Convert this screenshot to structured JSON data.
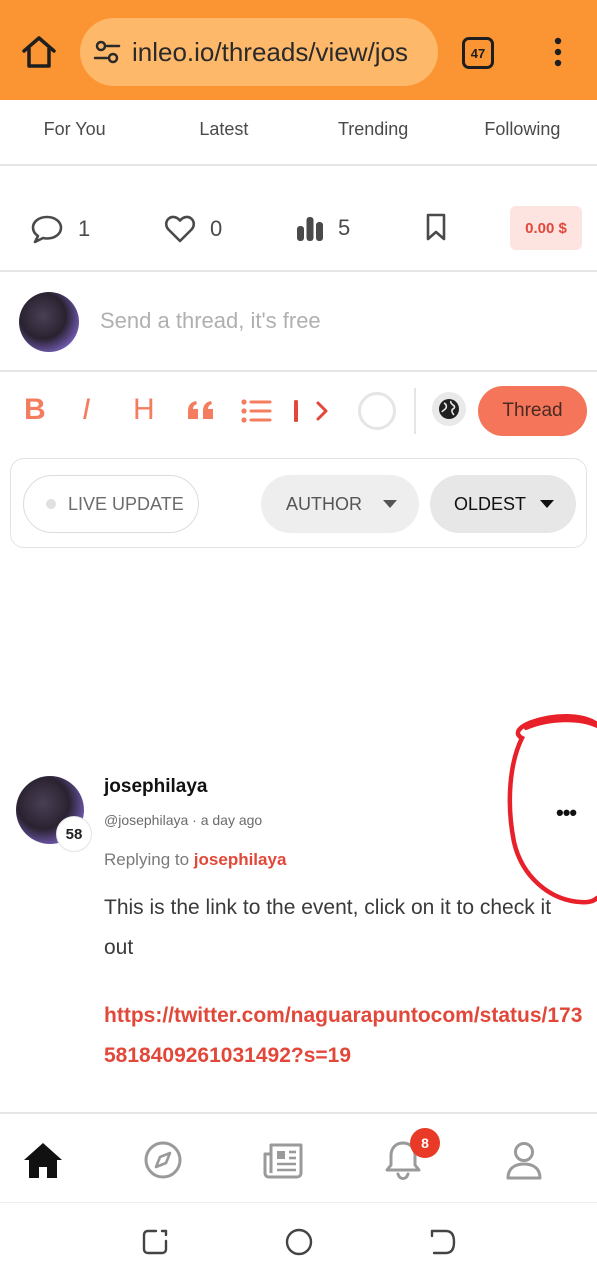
{
  "browser": {
    "url": "inleo.io/threads/view/jos",
    "tab_count": "47",
    "accent_color": "#fb9533"
  },
  "feed_tabs": [
    {
      "label": "For You"
    },
    {
      "label": "Latest"
    },
    {
      "label": "Trending"
    },
    {
      "label": "Following"
    }
  ],
  "stats": {
    "comments": "1",
    "likes": "0",
    "views": "5",
    "price": "0.00 $"
  },
  "compose": {
    "placeholder": "Send a thread, it's free"
  },
  "toolbar": {
    "bold": "B",
    "italic": "I",
    "heading": "H",
    "thread_button": "Thread",
    "icons": [
      "bold-icon",
      "italic-icon",
      "heading-icon",
      "quote-icon",
      "list-icon",
      "more-arrow-icon",
      "globe-icon"
    ]
  },
  "filters": {
    "live_update": "LIVE UPDATE",
    "author": "AUTHOR",
    "sort": "OLDEST"
  },
  "post": {
    "author": "josephilaya",
    "handle": "@josephilaya",
    "separator": "·",
    "time": "a day ago",
    "level": "58",
    "replying_to_label": "Replying to",
    "replying_to_user": "josephilaya",
    "body": "This is the link to the event, click on it to check it out",
    "link": "https://twitter.com/naguarapuntocom/status/1735818409261031492?s=19"
  },
  "bottom_nav": {
    "items": [
      "home-icon",
      "explore-icon",
      "news-icon",
      "notifications-icon",
      "profile-icon"
    ],
    "notifications_count": "8"
  },
  "system_nav": {
    "items": [
      "recent-apps-icon",
      "home-circle-icon",
      "back-icon"
    ]
  },
  "colors": {
    "brand": "#f4755a",
    "link": "#e2483a",
    "annotation": "#e8202a"
  }
}
